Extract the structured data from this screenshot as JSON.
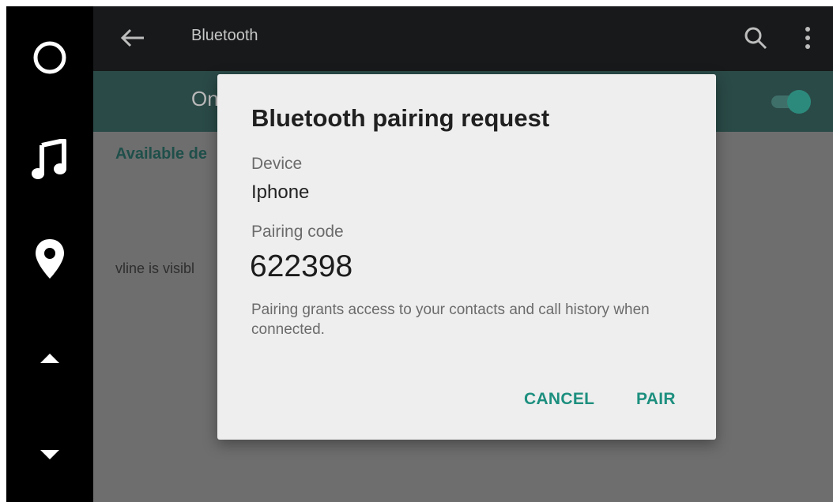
{
  "toolbar": {
    "title": "Bluetooth"
  },
  "main": {
    "on_label": "On",
    "available_devices": "Available de",
    "visible_text": "vline is visibl"
  },
  "dialog": {
    "title": "Bluetooth pairing request",
    "device_label": "Device",
    "device_value": "Iphone",
    "code_label": "Pairing code",
    "code_value": "622398",
    "note": "Pairing grants access to your contacts and call history when connected.",
    "cancel_label": "CANCEL",
    "pair_label": "PAIR"
  },
  "icons": {
    "rail": [
      "home-icon",
      "music-icon",
      "location-pin-icon",
      "arrow-up-icon",
      "arrow-down-icon"
    ],
    "toolbar": [
      "back-arrow-icon",
      "search-icon",
      "more-vert-icon"
    ]
  },
  "colors": {
    "accent": "#1d8f7f",
    "toggle_on": "#2c8a7c",
    "scrim": "#6e6e6e"
  },
  "bluetooth_enabled": true
}
